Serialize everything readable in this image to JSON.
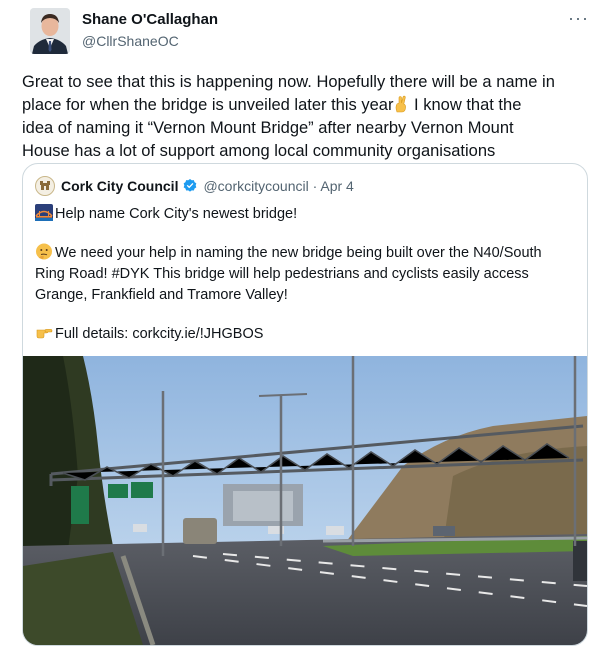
{
  "tweet": {
    "author_name": "Shane O'Callaghan",
    "author_handle": "@CllrShaneOC",
    "more_icon": "more-options-icon",
    "text_lines": [
      "Great to see that this is happening now. Hopefully there will be a name in",
      "place for when the bridge is unveiled later this year",
      " I know that the",
      "idea of naming it “Vernon Mount Bridge” after nearby Vernon Mount",
      "House has a lot of support among local community organisations"
    ]
  },
  "quote": {
    "author_name": "Cork City Council",
    "verified_icon": "verified-badge-icon",
    "handle_date": "@corkcitycouncil · Apr 4",
    "line1": "Help name Cork City's newest bridge!",
    "line2a": "We need your help in naming the new bridge being built over the N40/South",
    "line2b": "Ring Road! #DYK This bridge will help pedestrians and cyclists easily access",
    "line2c": "Grange, Frankfield and Tramore Valley!",
    "line3": "Full details: corkcity.ie/!JHGBOS"
  },
  "colors": {
    "text": "#0f1419",
    "secondary": "#536471",
    "border": "#cfd9de",
    "verified": "#1d9bf0"
  }
}
